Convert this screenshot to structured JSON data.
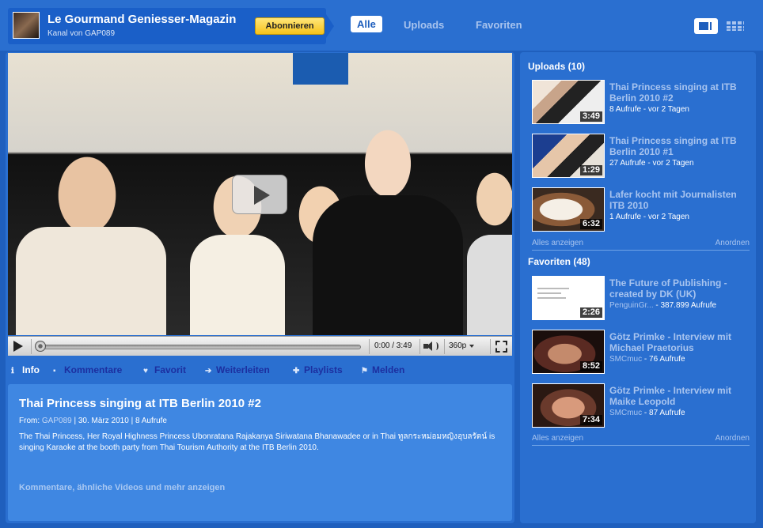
{
  "header": {
    "channel_title": "Le Gourmand Geniesser-Magazin",
    "channel_sub": "Kanal von GAP089",
    "subscribe_label": "Abonnieren",
    "tabs": [
      {
        "label": "Alle",
        "active": true
      },
      {
        "label": "Uploads",
        "active": false
      },
      {
        "label": "Favoriten",
        "active": false
      }
    ]
  },
  "player": {
    "time": "0:00 / 3:49",
    "quality": "360p"
  },
  "actions": [
    {
      "label": "Info",
      "icon": "info-icon"
    },
    {
      "label": "Kommentare",
      "icon": "comment-icon"
    },
    {
      "label": "Favorit",
      "icon": "heart-icon"
    },
    {
      "label": "Weiterleiten",
      "icon": "share-arrow-icon"
    },
    {
      "label": "Playlists",
      "icon": "plus-icon"
    },
    {
      "label": "Melden",
      "icon": "flag-icon"
    }
  ],
  "info": {
    "title": "Thai Princess singing at ITB Berlin 2010 #2",
    "from_label": "From:",
    "from_user": "GAP089",
    "meta_rest": "| 30. März 2010 | 8 Aufrufe",
    "description": "The Thai Princess, Her Royal Highness Princess Ubonratana Rajakanya Siriwatana Bhanawadee or in Thai ทูลกระหม่อมหญิงอุบลรัตน์ is singing Karaoke at the booth party from Thai Tourism Authority at the ITB Berlin 2010.",
    "more_link": "Kommentare, ähnliche Videos und mehr anzeigen"
  },
  "uploads": {
    "title": "Uploads (10)",
    "items": [
      {
        "title": "Thai Princess singing at ITB Berlin 2010 #2",
        "meta": "8 Aufrufe - vor 2 Tagen",
        "duration": "3:49"
      },
      {
        "title": "Thai Princess singing at ITB Berlin 2010 #1",
        "meta": "27 Aufrufe - vor 2 Tagen",
        "duration": "1:29"
      },
      {
        "title": "Lafer kocht mit Journalisten ITB 2010",
        "meta": "1 Aufrufe - vor 2 Tagen",
        "duration": "6:32"
      }
    ],
    "show_all": "Alles anzeigen",
    "arrange": "Anordnen"
  },
  "favorites": {
    "title": "Favoriten (48)",
    "items": [
      {
        "title": "The Future of Publishing - created by DK (UK)",
        "source": "PenguinGr...",
        "meta": "- 387.899 Aufrufe",
        "duration": "2:26"
      },
      {
        "title": "Götz Primke - Interview mit Michael Praetorius",
        "source": "SMCmuc",
        "meta": "- 76 Aufrufe",
        "duration": "8:52"
      },
      {
        "title": "Götz Primke - Interview mit Maike Leopold",
        "source": "SMCmuc",
        "meta": "- 87 Aufrufe",
        "duration": "7:34"
      }
    ],
    "show_all": "Alles anzeigen",
    "arrange": "Anordnen"
  }
}
